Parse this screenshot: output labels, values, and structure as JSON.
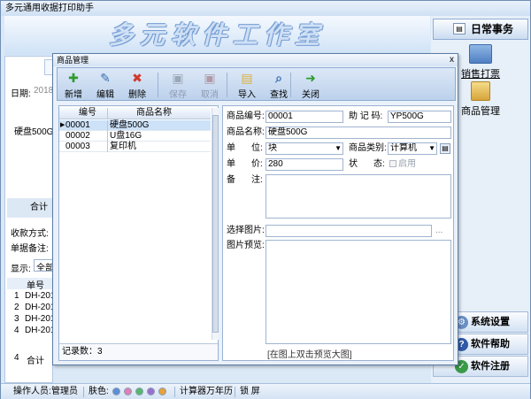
{
  "app": {
    "title": "多元通用收据打印助手",
    "banner": "多元软件工作室"
  },
  "right_panel": {
    "header": "日常事务",
    "items": [
      "销售打票",
      "商品管理"
    ],
    "bottom_buttons": [
      "系统设置",
      "软件帮助",
      "软件注册"
    ]
  },
  "background_form": {
    "date_label": "日期:",
    "date_value": "2018",
    "item_value": "硬盘500G",
    "total_tab": "合计",
    "payment_label": "收款方式:",
    "remark_label": "单据备注:",
    "display_label": "显示:",
    "display_value": "全部",
    "grid_header": "单号",
    "grid_rows": [
      {
        "n": "1",
        "value": "DH-201"
      },
      {
        "n": "2",
        "value": "DH-201"
      },
      {
        "n": "3",
        "value": "DH-201"
      },
      {
        "n": "4",
        "value": "DH-201"
      }
    ],
    "grid_total_n": "4",
    "grid_total": "合计"
  },
  "status_bar": {
    "operator_label": "操作人员:",
    "operator": "管理员",
    "skin_label": "肤色:",
    "skin_colors": [
      "#5b8fd6",
      "#e07fb4",
      "#55b86a",
      "#9b6fd0",
      "#e8a23a"
    ],
    "calculator": "计算器",
    "calendar": "万年历",
    "lock": "锁 屏"
  },
  "dialog": {
    "title": "商品管理",
    "close": "x",
    "toolbar": [
      {
        "label": "新增",
        "icon": "plus-icon",
        "glyph": "✚",
        "color": "#2e9b2e",
        "enabled": true
      },
      {
        "label": "编辑",
        "icon": "edit-icon",
        "glyph": "✎",
        "color": "#3a6fb0",
        "enabled": true
      },
      {
        "label": "删除",
        "icon": "delete-icon",
        "glyph": "✖",
        "color": "#d03a2a",
        "enabled": true
      },
      {
        "label": "保存",
        "icon": "save-icon",
        "glyph": "▣",
        "color": "#9aa7b8",
        "enabled": false
      },
      {
        "label": "取消",
        "icon": "cancel-icon",
        "glyph": "▣",
        "color": "#b09aa8",
        "enabled": false
      },
      {
        "label": "导入",
        "icon": "import-icon",
        "glyph": "▤",
        "color": "#d9b13a",
        "enabled": true
      },
      {
        "label": "查找",
        "icon": "find-icon",
        "glyph": "⌕",
        "color": "#3a6fb0",
        "enabled": true
      },
      {
        "label": "关闭",
        "icon": "exit-icon",
        "glyph": "➜",
        "color": "#2e9b2e",
        "enabled": true
      }
    ],
    "list": {
      "columns": [
        "编号",
        "商品名称"
      ],
      "rows": [
        {
          "code": "00001",
          "name": "硬盘500G",
          "selected": true
        },
        {
          "code": "00002",
          "name": "U盘16G",
          "selected": false
        },
        {
          "code": "00003",
          "name": "复印机",
          "selected": false
        }
      ],
      "record_count": "记录数：3"
    },
    "form": {
      "code_label": "商品编号:",
      "code_value": "00001",
      "mnemonic_label": "助 记 码:",
      "mnemonic_value": "YP500G",
      "name_label": "商品名称:",
      "name_value": "硬盘500G",
      "unit_label_a": "单",
      "unit_label_b": "位:",
      "unit_value": "块",
      "category_label": "商品类别:",
      "category_value": "计算机",
      "price_label_a": "单",
      "price_label_b": "价:",
      "price_value": "280",
      "status_label_a": "状",
      "status_label_b": "态:",
      "status_option": "启用",
      "note_label_a": "备",
      "note_label_b": "注:",
      "image_label": "选择图片:",
      "image_browse": "...",
      "preview_label": "图片预览:",
      "preview_hint": "[在图上双击预览大图]"
    }
  }
}
